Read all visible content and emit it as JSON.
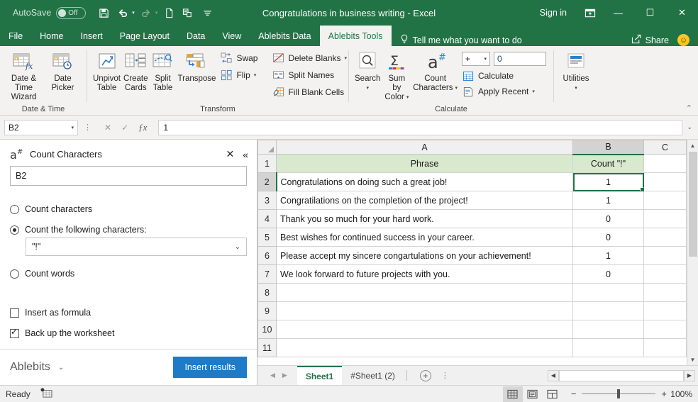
{
  "titlebar": {
    "autosave_label": "AutoSave",
    "autosave_state": "Off",
    "document_title": "Congratulations in business writing  -  Excel",
    "signin_label": "Sign in",
    "qat": [
      {
        "name": "save-icon",
        "glyph": "💾"
      },
      {
        "name": "undo-icon",
        "glyph": "↶"
      },
      {
        "name": "redo-icon",
        "glyph": "↷"
      },
      {
        "name": "new-file-icon",
        "glyph": "🗋"
      },
      {
        "name": "quick-print-icon",
        "glyph": "🖨"
      },
      {
        "name": "customize-qat-icon",
        "glyph": "⌄"
      }
    ],
    "window": {
      "ribbon_display": "⬒",
      "minimize": "—",
      "maximize": "☐",
      "close": "✕"
    }
  },
  "tabs": {
    "items": [
      {
        "label": "File",
        "active": false
      },
      {
        "label": "Home",
        "active": false
      },
      {
        "label": "Insert",
        "active": false
      },
      {
        "label": "Page Layout",
        "active": false
      },
      {
        "label": "Data",
        "active": false
      },
      {
        "label": "View",
        "active": false
      },
      {
        "label": "Ablebits Data",
        "active": false
      },
      {
        "label": "Ablebits Tools",
        "active": true
      }
    ],
    "tell_me": "Tell me what you want to do",
    "share_label": "Share"
  },
  "ribbon": {
    "groups": [
      {
        "label": "Date & Time",
        "buttons": [
          {
            "label1": "Date &",
            "label2": "Time Wizard",
            "icon": "date-time-wizard-icon"
          },
          {
            "label1": "Date",
            "label2": "Picker",
            "icon": "date-picker-icon"
          }
        ]
      },
      {
        "label": "Transform",
        "buttons": [
          {
            "label1": "Unpivot",
            "label2": "Table",
            "icon": "unpivot-table-icon"
          },
          {
            "label1": "Create",
            "label2": "Cards",
            "icon": "create-cards-icon"
          },
          {
            "label1": "Split",
            "label2": "Table",
            "icon": "split-table-icon"
          },
          {
            "label1": "Transpose",
            "label2": "",
            "icon": "transpose-icon"
          }
        ],
        "small_col_1": [
          {
            "label": "Swap",
            "icon": "swap-icon",
            "caret": false
          },
          {
            "label": "Flip",
            "icon": "flip-icon",
            "caret": true
          }
        ],
        "small_col_2": [
          {
            "label": "Delete Blanks",
            "icon": "delete-blanks-icon",
            "caret": true
          },
          {
            "label": "Split Names",
            "icon": "split-names-icon",
            "caret": false
          },
          {
            "label": "Fill Blank Cells",
            "icon": "fill-blank-cells-icon",
            "caret": false
          }
        ]
      },
      {
        "label": "Calculate",
        "buttons": [
          {
            "label1": "Search",
            "label2": "",
            "icon": "search-icon",
            "caret": true
          },
          {
            "label1": "Sum by",
            "label2": "Color",
            "icon": "sum-by-color-icon",
            "caret": true
          },
          {
            "label1": "Count",
            "label2": "Characters",
            "icon": "count-characters-icon",
            "caret": true
          }
        ],
        "operator": "+",
        "operand_value": "0",
        "small_items": [
          {
            "label": "Calculate",
            "icon": "calculate-icon",
            "caret": false
          },
          {
            "label": "Apply Recent",
            "icon": "apply-recent-icon",
            "caret": true
          }
        ]
      },
      {
        "label": "",
        "buttons": [
          {
            "label1": "Utilities",
            "label2": "",
            "icon": "utilities-icon",
            "caret": true
          }
        ]
      }
    ],
    "collapse_glyph": "⌃"
  },
  "formula_bar": {
    "name_box": "B2",
    "cancel_glyph": "✕",
    "confirm_glyph": "✓",
    "fx_label": "ƒx",
    "formula_value": "1",
    "expand_glyph": "⌄"
  },
  "panel": {
    "icon_glyph": "a",
    "icon_sup": "#",
    "title": "Count Characters",
    "close_glyph": "✕",
    "collapse_glyph": "«",
    "range_value": "B2",
    "option_count_characters": "Count characters",
    "option_count_following": "Count the following characters:",
    "chars_value": "\"!\"",
    "option_count_words": "Count words",
    "check_insert_formula": "Insert as formula",
    "check_backup": "Back up the worksheet",
    "brand_label": "Ablebits",
    "brand_caret": "⌄",
    "insert_button": "Insert results"
  },
  "grid": {
    "columns": [
      {
        "label": "A",
        "selected": false
      },
      {
        "label": "B",
        "selected": true
      },
      {
        "label": "C",
        "selected": false
      }
    ],
    "rows": [
      {
        "num": "1",
        "header": true,
        "a": "Phrase",
        "b": "Count \"!\"",
        "selected": false
      },
      {
        "num": "2",
        "header": false,
        "a": "Congratulations on doing such a great job!",
        "b": "1",
        "selected": true
      },
      {
        "num": "3",
        "header": false,
        "a": "Congratilations on the completion of the project!",
        "b": "1",
        "selected": false
      },
      {
        "num": "4",
        "header": false,
        "a": "Thank you so much for your hard work.",
        "b": "0",
        "selected": false
      },
      {
        "num": "5",
        "header": false,
        "a": "Best wishes for continued success in your career.",
        "b": "0",
        "selected": false
      },
      {
        "num": "6",
        "header": false,
        "a": "Please accept my sincere congartulations on your achievement!",
        "b": "1",
        "selected": false
      },
      {
        "num": "7",
        "header": false,
        "a": "We look forward to future projects with you.",
        "b": "0",
        "selected": false
      },
      {
        "num": "8",
        "header": false,
        "a": "",
        "b": "",
        "selected": false
      },
      {
        "num": "9",
        "header": false,
        "a": "",
        "b": "",
        "selected": false
      },
      {
        "num": "10",
        "header": false,
        "a": "",
        "b": "",
        "selected": false
      },
      {
        "num": "11",
        "header": false,
        "a": "",
        "b": "",
        "selected": false
      }
    ]
  },
  "sheet_tabs": {
    "prev_glyph": "◀",
    "next_glyph": "▶",
    "items": [
      {
        "label": "Sheet1",
        "active": true
      },
      {
        "label": "#Sheet1 (2)",
        "active": false
      }
    ],
    "add_glyph": "+",
    "menu_glyph": "⋮"
  },
  "status_bar": {
    "status_text": "Ready",
    "macro_icon": "record-macro-icon",
    "views": [
      {
        "name": "normal-view-button",
        "glyph": "▦",
        "active": true
      },
      {
        "name": "page-layout-view-button",
        "glyph": "▤",
        "active": false
      },
      {
        "name": "page-break-view-button",
        "glyph": "▥",
        "active": false
      }
    ],
    "zoom_out": "−",
    "zoom_in": "+",
    "zoom_level": "100%"
  },
  "colors": {
    "excel_green": "#217346",
    "header_fill": "#d8e9cd",
    "accent_blue": "#1e7bc8"
  }
}
